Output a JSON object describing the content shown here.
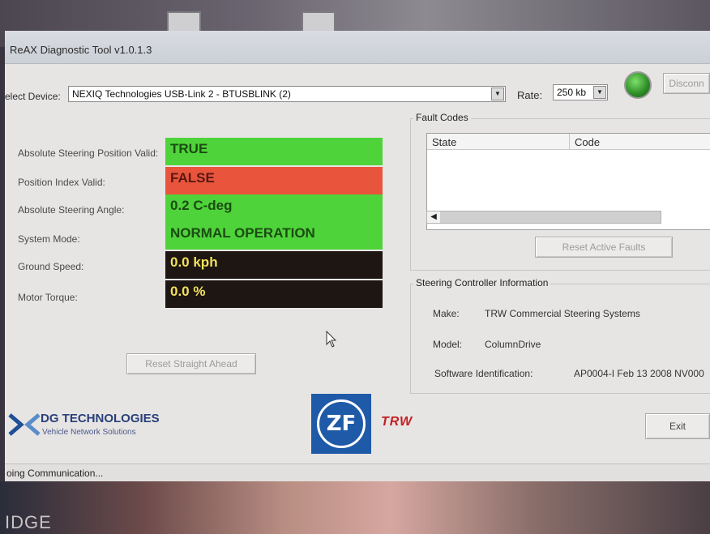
{
  "window": {
    "title": "ReAX Diagnostic Tool v1.0.1.3"
  },
  "device_row": {
    "device_label": "elect Device:",
    "device_value": "NEXIQ Technologies USB-Link 2 - BTUSBLINK (2)",
    "rate_label": "Rate:",
    "rate_value": "250 kb",
    "disconnect_label": "Disconn",
    "status_led_color": "#2c8a25"
  },
  "parameters": [
    {
      "label": "Absolute Steering Position Valid:",
      "value": "TRUE",
      "bg": "#4fd33a",
      "fg": "#1b4c13"
    },
    {
      "label": "Position Index Valid:",
      "value": "FALSE",
      "bg": "#e8553c",
      "fg": "#5a1812"
    },
    {
      "label": "Absolute Steering Angle:",
      "value": "0.2 C-deg",
      "bg": "#4fd33a",
      "fg": "#1b4c13"
    },
    {
      "label": "System Mode:",
      "value": "NORMAL OPERATION",
      "bg": "#4fd33a",
      "fg": "#1b4c13"
    },
    {
      "label": "Ground Speed:",
      "value": "0.0 kph",
      "bg": "#1d1612",
      "fg": "#f2e15a"
    },
    {
      "label": "Motor Torque:",
      "value": "0.0 %",
      "bg": "#1d1612",
      "fg": "#f2e15a"
    }
  ],
  "buttons": {
    "reset_straight_ahead": "Reset Straight Ahead",
    "reset_active_faults": "Reset Active Faults",
    "exit": "Exit"
  },
  "fault_codes": {
    "title": "Fault Codes",
    "columns": [
      "State",
      "Code"
    ]
  },
  "controller_info": {
    "title": "Steering Controller Information",
    "make_label": "Make:",
    "make_value": "TRW Commercial Steering Systems",
    "model_label": "Model:",
    "model_value": "ColumnDrive",
    "software_label": "Software Identification:",
    "software_value": "AP0004-I Feb 13 2008 NV000"
  },
  "branding": {
    "dg_name": "DG TECHNOLOGIES",
    "dg_tagline": "Vehicle Network Solutions",
    "zf_mark": "ZF",
    "trw_mark": "TRW"
  },
  "status_bar": {
    "text": "oing Communication..."
  },
  "photo_text": "IDGE"
}
